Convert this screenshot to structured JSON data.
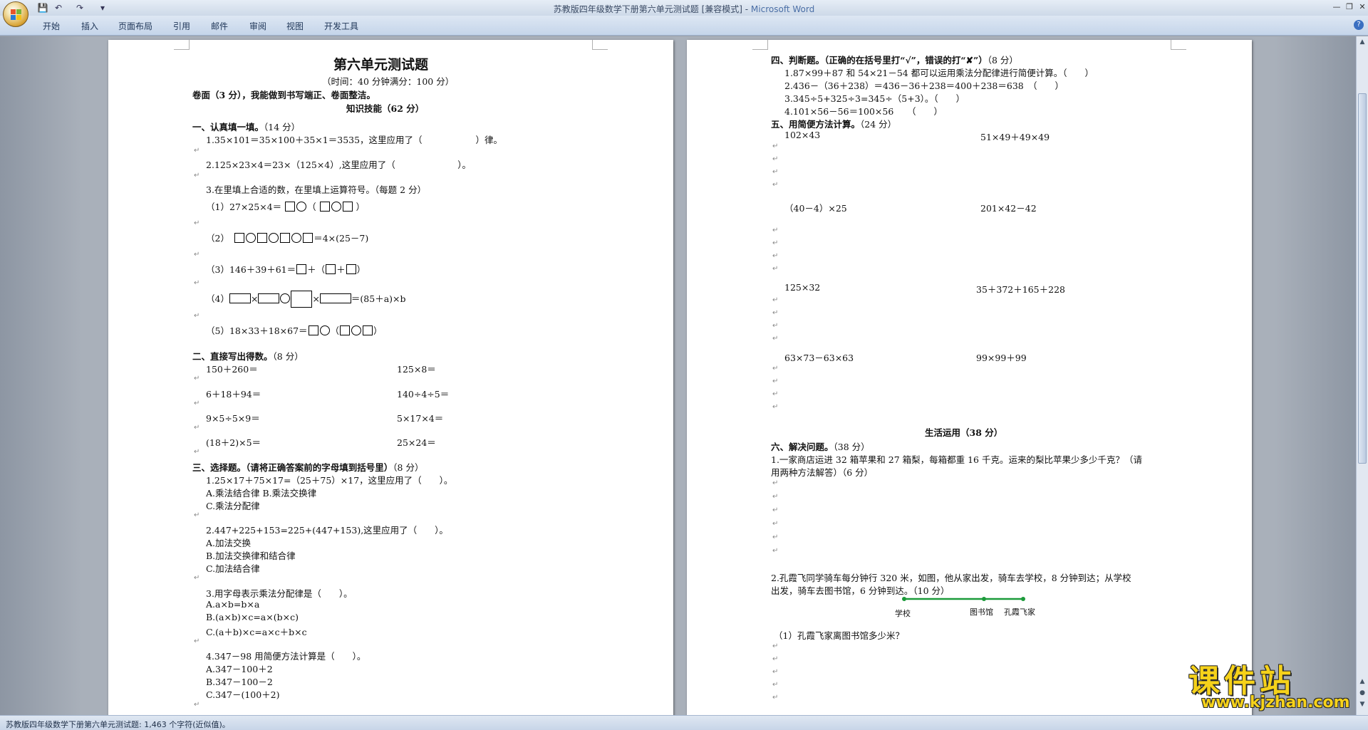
{
  "window": {
    "title": "苏教版四年级数学下册第六单元测试题 [兼容模式] - ",
    "app": "Microsoft Word"
  },
  "quick_access": {
    "save": "💾",
    "undo": "↶",
    "redo": "↷",
    "more": "▾"
  },
  "window_controls": {
    "minimize": "—",
    "restore": "❐",
    "close": "✕"
  },
  "ribbon": {
    "tabs": [
      "开始",
      "插入",
      "页面布局",
      "引用",
      "邮件",
      "审阅",
      "视图",
      "开发工具"
    ],
    "help": "?"
  },
  "left_page": {
    "title": "第六单元测试题",
    "subtitle": "（时间：40 分钟满分：100 分）",
    "neatness": "卷面（3 分）",
    "neatness_rest": "我能做到书写端正、卷面整洁。",
    "section_skill": "知识技能（62 分）",
    "s1_title": "一、认真填一填。",
    "s1_score": "（14 分）",
    "q1_1": "1.35×101＝35×100＋35×1＝3535，这里应用了（　　　　　　）律。",
    "q1_2": "2.125×23×4＝23×（125×4）,这里应用了（　　　　　　　）。",
    "q1_3": "3.在里填上合适的数，在里填上运算符号。（每题 2 分）",
    "q1_3_1_pre": "（1）27×25×4＝",
    "q1_3_2_pre": "（2）",
    "q1_3_2_post": "＝4×(25－7)",
    "q1_3_3_pre": "（3）146＋39＋61＝",
    "q1_3_4_pre": "（4）",
    "q1_3_4_post": "＝(85＋a)×b",
    "q1_3_5_pre": "（5）18×33＋18×67＝",
    "s2_title": "二、直接写出得数。",
    "s2_score": "（8 分）",
    "s2_items": [
      "150＋260＝",
      "125×8＝",
      "6＋18＋94＝",
      "140÷4÷5＝",
      "9×5÷5×9＝",
      "5×17×4＝",
      "(18＋2)×5＝",
      "25×24＝"
    ],
    "s3_title": "三、选择题。（请将正确答案前的字母填到括号里）",
    "s3_score": "（8 分）",
    "q3_1": "1.25×17＋75×17=（25＋75）×17，这里应用了（　　）。",
    "q3_1_a": "A.乘法结合律 B.乘法交换律",
    "q3_1_c": "C.乘法分配律",
    "q3_2": "2.447+225+153=225+(447+153),这里应用了（　　）。",
    "q3_2_a": "A.加法交换",
    "q3_2_b": "B.加法交换律和结合律",
    "q3_2_c": "C.加法结合律",
    "q3_3": "3.用字母表示乘法分配律是（　　）。",
    "q3_3_a": "A.a×b=b×a",
    "q3_3_b": "B.(a×b)×c=a×(b×c)",
    "q3_3_c": "C.(a＋b)×c=a×c＋b×c",
    "q3_4": "4.347－98 用简便方法计算是（　　）。",
    "q3_4_a": "A.347－100＋2",
    "q3_4_b": "B.347－100－2",
    "q3_4_c": "C.347－(100＋2)"
  },
  "right_page": {
    "s4_title": "四、判断题。（正确的在括号里打“√”，错误的打“✘”）",
    "s4_score": "（8 分）",
    "q4_1": "1.87×99＋87 和 54×21－54 都可以运用乘法分配律进行简便计算。（　　）",
    "q4_2": "2.436－（36＋238）＝436－36＋238＝400＋238＝638　（　　）",
    "q4_3": "3.345÷5+325÷3=345÷（5+3）。（　　）",
    "q4_4": "4.101×56－56＝100×56　　（　　）",
    "s5_title": "五、用简便方法计算。",
    "s5_score": "（24 分）",
    "s5_items": [
      "102×43",
      "51×49＋49×49",
      "（40－4）×25",
      "201×42－42",
      "125×32",
      "35＋372＋165＋228",
      "63×73－63×63",
      "99×99＋99"
    ],
    "section_life": "生活运用（38 分）",
    "s6_title": "六、解决问题。",
    "s6_score": "（38 分）",
    "q6_1a": "1.一家商店运进 32 箱苹果和 27 箱梨，每箱都重 16 千克。运来的梨比苹果少多少千克？（请",
    "q6_1b": "用两种方法解答）（6 分）",
    "q6_2a": "2.孔霞飞同学骑车每分钟行 320 米，如图，他从家出发，骑车去学校，8 分钟到达；从学校",
    "q6_2b": "出发，骑车去图书馆，6 分钟到达。（10 分）",
    "route_labels": [
      "学校",
      "图书馆",
      "孔霞飞家"
    ],
    "route_color": "#1c9b3a",
    "q6_2_1": "（1）孔霞飞家离图书馆多少米？"
  },
  "return_mark": "↵",
  "status": "苏教版四年级数学下册第六单元测试题: 1,463 个字符(近似值)。",
  "watermark": {
    "big": "课件站",
    "small": "www.kjzhan.com"
  }
}
